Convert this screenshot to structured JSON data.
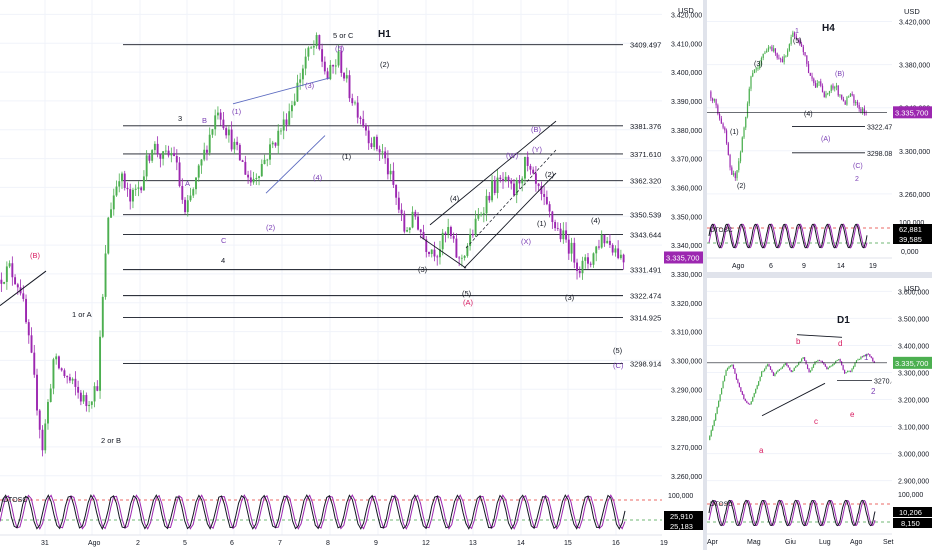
{
  "colors": {
    "up": "#4caf50",
    "down": "#9c27b0",
    "wave_purple": "#7b3fb5",
    "wave_pink": "#d81b60",
    "level": "#131722",
    "grid": "#f0f3fa",
    "osc_k": "#131722",
    "osc_d": "#9c27b0",
    "osc_hi": "#e53935",
    "osc_lo": "#43a047"
  },
  "h1": {
    "title": "H1",
    "currency": "USD",
    "price_tag": "3.335,700",
    "y_range": [
      3262000,
      3425000
    ],
    "y_ticks": [
      "3.420,000",
      "3.410,000",
      "3.400,000",
      "3.390,000",
      "3.380,000",
      "3.370,000",
      "3.360,000",
      "3.350,000",
      "3.340,000",
      "3.330,000",
      "3.320,000",
      "3.310,000",
      "3.300,000",
      "3.290,000",
      "3.280,000",
      "3.270,000",
      "3.260,000"
    ],
    "x_ticks": [
      "31",
      "Ago",
      "2",
      "5",
      "6",
      "7",
      "8",
      "9",
      "12",
      "13",
      "14",
      "15",
      "16",
      "19"
    ],
    "levels": [
      {
        "label": "3409.497",
        "value": 3409497
      },
      {
        "label": "3381.376",
        "value": 3381376
      },
      {
        "label": "3371.610",
        "value": 3371610
      },
      {
        "label": "3362.320",
        "value": 3362320
      },
      {
        "label": "3350.539",
        "value": 3350539
      },
      {
        "label": "3343.644",
        "value": 3343644
      },
      {
        "label": "3331.491",
        "value": 3331491
      },
      {
        "label": "3322.474",
        "value": 3322474
      },
      {
        "label": "3314.925",
        "value": 3314925
      },
      {
        "label": "3298.914",
        "value": 3298914
      }
    ],
    "waves": [
      {
        "text": "5 or C",
        "color": "#131722"
      },
      {
        "text": "(5)",
        "color": "#7b3fb5"
      },
      {
        "text": "(2)",
        "color": "#131722"
      },
      {
        "text": "3",
        "color": "#131722"
      },
      {
        "text": "B",
        "color": "#7b3fb5"
      },
      {
        "text": "(1)",
        "color": "#7b3fb5"
      },
      {
        "text": "(3)",
        "color": "#7b3fb5"
      },
      {
        "text": "A",
        "color": "#7b3fb5"
      },
      {
        "text": "(1)",
        "color": "#131722"
      },
      {
        "text": "(4)",
        "color": "#7b3fb5"
      },
      {
        "text": "(2)",
        "color": "#7b3fb5"
      },
      {
        "text": "C",
        "color": "#7b3fb5"
      },
      {
        "text": "4",
        "color": "#131722"
      },
      {
        "text": "(B)",
        "color": "#d81b60"
      },
      {
        "text": "1 or A",
        "color": "#131722"
      },
      {
        "text": "2 or B",
        "color": "#131722"
      },
      {
        "text": "(B)",
        "color": "#7b3fb5"
      },
      {
        "text": "(W)",
        "color": "#7b3fb5"
      },
      {
        "text": "(Y)",
        "color": "#7b3fb5"
      },
      {
        "text": "(2)",
        "color": "#131722"
      },
      {
        "text": "(4)",
        "color": "#131722"
      },
      {
        "text": "(3)",
        "color": "#131722"
      },
      {
        "text": "(5)",
        "color": "#131722"
      },
      {
        "text": "(A)",
        "color": "#d81b60"
      },
      {
        "text": "(X)",
        "color": "#7b3fb5"
      },
      {
        "text": "(1)",
        "color": "#131722"
      },
      {
        "text": "(4)",
        "color": "#131722"
      },
      {
        "text": "(3)",
        "color": "#131722"
      },
      {
        "text": "(5)",
        "color": "#131722"
      },
      {
        "text": "(C)",
        "color": "#7b3fb5"
      }
    ],
    "osc": {
      "label": "DTOSC",
      "top_label": "100,000",
      "v1": "25,910",
      "v2": "25,183"
    }
  },
  "h4": {
    "title": "H4",
    "currency": "USD",
    "price_tag": "3.335,700",
    "y_ticks": [
      "3.420,000",
      "3.380,000",
      "3.340,000",
      "3.300,000",
      "3.260,000"
    ],
    "x_ticks": [
      "Ago",
      "6",
      "9",
      "14",
      "19"
    ],
    "levels": [
      {
        "label": "3322.474"
      },
      {
        "label": "3298.082"
      }
    ],
    "waves": [
      {
        "text": "1",
        "color": "#7b3fb5"
      },
      {
        "text": "(5)",
        "color": "#131722"
      },
      {
        "text": "(3)",
        "color": "#131722"
      },
      {
        "text": "(B)",
        "color": "#7b3fb5"
      },
      {
        "text": "(1)",
        "color": "#131722"
      },
      {
        "text": "(4)",
        "color": "#131722"
      },
      {
        "text": "(A)",
        "color": "#7b3fb5"
      },
      {
        "text": "(2)",
        "color": "#131722"
      },
      {
        "text": "(C)",
        "color": "#7b3fb5"
      },
      {
        "text": "2",
        "color": "#7b3fb5"
      }
    ],
    "osc": {
      "label": "DTOSC",
      "top_label": "100,000",
      "bot_label": "0,000",
      "v1": "62,881",
      "v2": "39,585"
    }
  },
  "d1": {
    "title": "D1",
    "currency": "USD",
    "price_tag": "3.335,700",
    "y_ticks": [
      "3.600,000",
      "3.500,000",
      "3.400,000",
      "3.300,000",
      "3.200,000",
      "3.100,000",
      "3.000,000",
      "2.900,000"
    ],
    "x_ticks": [
      "Apr",
      "Mag",
      "Giu",
      "Lug",
      "Ago",
      "Set"
    ],
    "level_label": "3270.42",
    "waves": [
      {
        "text": "b",
        "color": "#d81b60"
      },
      {
        "text": "d",
        "color": "#d81b60"
      },
      {
        "text": "1",
        "color": "#7b3fb5"
      },
      {
        "text": "2",
        "color": "#7b3fb5"
      },
      {
        "text": "c",
        "color": "#d81b60"
      },
      {
        "text": "e",
        "color": "#d81b60"
      },
      {
        "text": "a",
        "color": "#d81b60"
      }
    ],
    "osc": {
      "label": "DTOSC",
      "top_label": "100,000",
      "v1": "10,206",
      "v2": "8,150"
    }
  },
  "chart_data": [
    {
      "type": "candlestick",
      "title": "H1",
      "ylabel": "USD",
      "ylim": [
        3262000,
        3425000
      ],
      "close_path": [
        3328,
        3332,
        3325,
        3300,
        3270,
        3300,
        3295,
        3290,
        3285,
        3292,
        3350,
        3365,
        3355,
        3362,
        3375,
        3370,
        3372,
        3350,
        3362,
        3375,
        3388,
        3378,
        3370,
        3362,
        3368,
        3375,
        3382,
        3392,
        3405,
        3410,
        3398,
        3405,
        3393,
        3385,
        3376,
        3372,
        3360,
        3345,
        3350,
        3340,
        3338,
        3345,
        3334,
        3342,
        3352,
        3360,
        3362,
        3358,
        3368,
        3360,
        3352,
        3345,
        3340,
        3332,
        3335,
        3343,
        3340,
        3335
      ]
    },
    {
      "type": "candlestick",
      "title": "H4",
      "ylabel": "USD",
      "close_path": [
        3355,
        3345,
        3332,
        3320,
        3285,
        3272,
        3300,
        3330,
        3368,
        3375,
        3385,
        3392,
        3395,
        3388,
        3380,
        3395,
        3410,
        3402,
        3393,
        3372,
        3360,
        3362,
        3348,
        3356,
        3362,
        3350,
        3345,
        3352,
        3344,
        3338,
        3335
      ]
    },
    {
      "type": "candlestick",
      "title": "D1",
      "ylabel": "USD",
      "close_path": [
        3050,
        3120,
        3220,
        3310,
        3330,
        3260,
        3200,
        3180,
        3240,
        3300,
        3330,
        3290,
        3310,
        3335,
        3300,
        3330,
        3355,
        3300,
        3340,
        3345,
        3315,
        3330,
        3350,
        3300,
        3305,
        3345,
        3360,
        3370,
        3335
      ]
    }
  ]
}
